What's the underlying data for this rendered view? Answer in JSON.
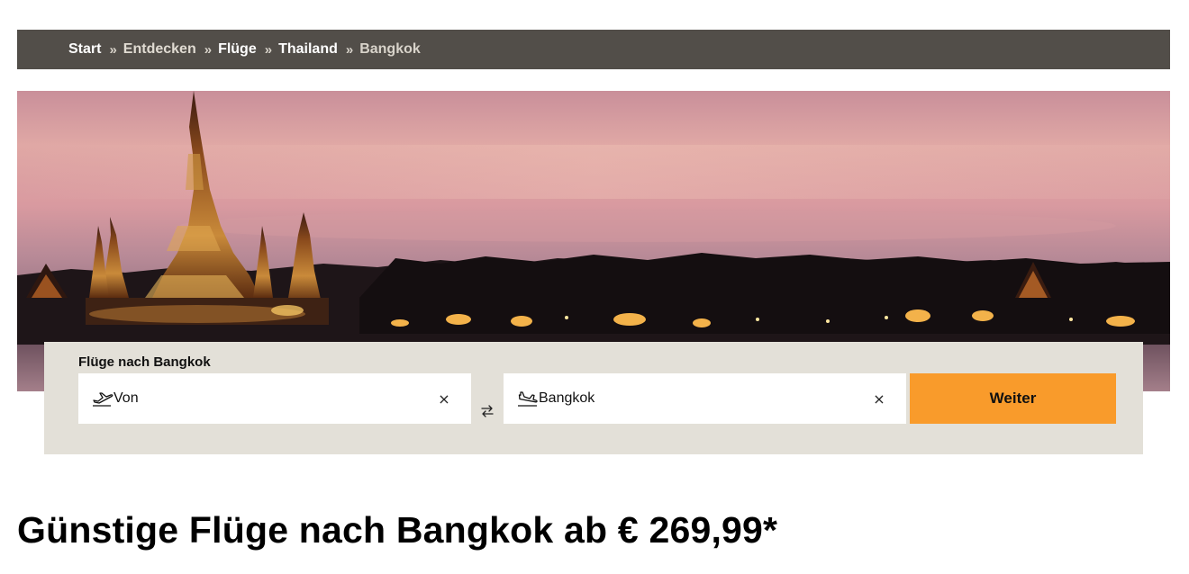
{
  "breadcrumb": {
    "items": [
      {
        "label": "Start"
      },
      {
        "label": "Entdecken"
      },
      {
        "label": "Flüge"
      },
      {
        "label": "Thailand"
      },
      {
        "label": "Bangkok"
      }
    ],
    "separator": "»"
  },
  "hero": {
    "image": "bangkok-temple-skyline-sunset"
  },
  "search": {
    "title": "Flüge nach Bangkok",
    "from": {
      "value": "Von",
      "icon": "plane-departure-icon",
      "clear": "×"
    },
    "swap_icon": "swap-arrows-icon",
    "to": {
      "value": "Bangkok",
      "icon": "plane-arrival-icon",
      "clear": "×"
    },
    "submit_label": "Weiter"
  },
  "heading": "Günstige Flüge nach Bangkok ab € 269,99*",
  "colors": {
    "breadcrumb_bg": "#524e49",
    "panel_bg": "#e3e0d8",
    "accent": "#f99b2b"
  }
}
